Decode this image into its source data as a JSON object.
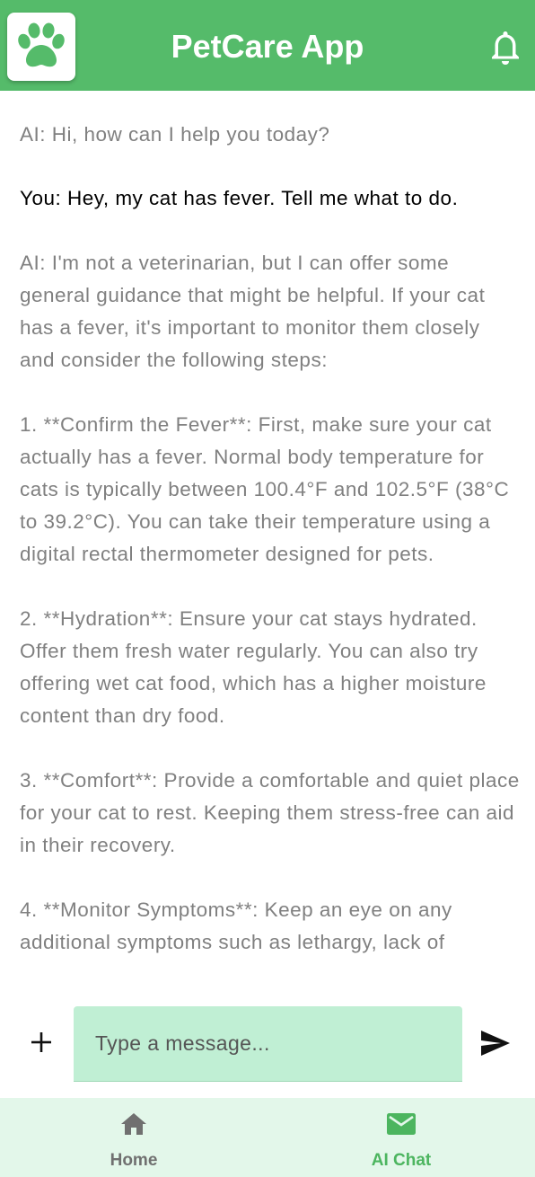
{
  "header": {
    "title": "PetCare App",
    "logo_icon": "paw-icon",
    "notification_icon": "bell-icon",
    "bar_color": "#55bb6a"
  },
  "chat": {
    "messages": [
      {
        "sender": "AI",
        "text": "AI: Hi, how can I help you today?"
      },
      {
        "sender": "You",
        "text": "You: Hey, my cat has fever. Tell me what to do."
      },
      {
        "sender": "AI",
        "text": "AI: I'm not a veterinarian, but I can offer some general guidance that might be helpful. If your cat has a fever, it's important to monitor them closely and consider the following steps:\n\n1. **Confirm the Fever**: First, make sure your cat actually has a fever. Normal body temperature for cats is typically between 100.4°F and 102.5°F (38°C to 39.2°C). You can take their temperature using a digital rectal thermometer designed for pets.\n\n2. **Hydration**: Ensure your cat stays hydrated. Offer them fresh water regularly. You can also try offering wet cat food, which has a higher moisture content than dry food.\n\n3. **Comfort**: Provide a comfortable and quiet place for your cat to rest. Keeping them stress-free can aid in their recovery.\n\n4. **Monitor Symptoms**: Keep an eye on any additional symptoms such as lethargy, lack of"
      }
    ]
  },
  "composer": {
    "placeholder": "Type a message...",
    "value": "",
    "attach_icon": "plus-icon",
    "send_icon": "send-icon"
  },
  "bottom_nav": {
    "items": [
      {
        "label": "Home",
        "icon": "home-icon",
        "active": false
      },
      {
        "label": "AI Chat",
        "icon": "mail-icon",
        "active": true
      }
    ],
    "active_color": "#4cb55f",
    "background": "#e3f7ea"
  }
}
